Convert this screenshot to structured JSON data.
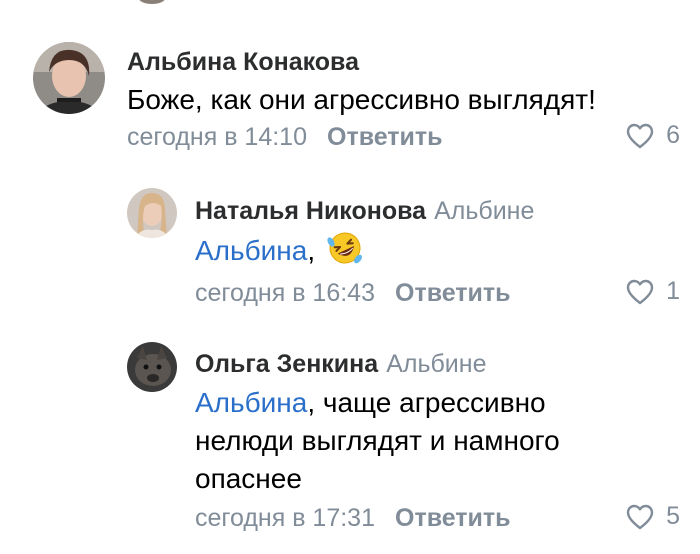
{
  "comments": [
    {
      "author": "Альбина Конакова",
      "reply_to": "",
      "text": "Боже, как они агрессивно выглядят!",
      "time": "сегодня в 14:10",
      "reply_label": "Ответить",
      "likes": "6"
    },
    {
      "author": "Наталья Никонова",
      "reply_to": "Альбине",
      "mention": "Альбина",
      "text_after": ",",
      "emoji": "rolling-on-floor-laughing-emoji",
      "time": "сегодня в 16:43",
      "reply_label": "Ответить",
      "likes": "1"
    },
    {
      "author": "Ольга Зенкина",
      "reply_to": "Альбине",
      "mention": "Альбина",
      "text_line1": ", чаще агрессивно",
      "text_line2": "нелюди выглядят и намного",
      "text_line3": "опаснее",
      "time": "сегодня в 17:31",
      "reply_label": "Ответить",
      "likes": "5"
    }
  ],
  "colors": {
    "secondary_text": "#818c99",
    "mention": "#2a6fc9",
    "author": "#2c2d2e"
  }
}
